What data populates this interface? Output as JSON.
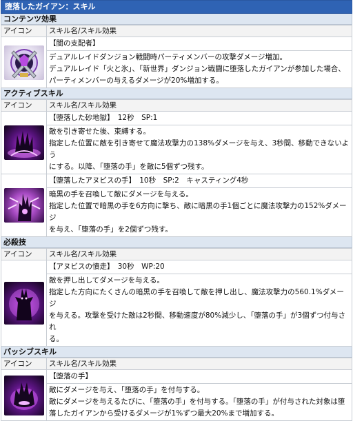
{
  "title": "堕落したガイアン：スキル",
  "header": {
    "icon": "アイコン",
    "name": "スキル名/スキル効果"
  },
  "sections": [
    {
      "label": "コンテンツ効果",
      "skills": [
        {
          "icon": "crossed-swords-crest-icon",
          "name": "【闇の支配者】",
          "lines": [
            "デュアルレイドダンジョン戦闘時パーティメンバーの攻撃ダメージ増加。",
            "デュアルレイド「火と氷」、「新世界」ダンジョン戦闘に堕落したガイアンが参加した場合、",
            "パーティメンバーの与えるダメージが20%増加する。"
          ]
        }
      ]
    },
    {
      "label": "アクティブスキル",
      "skills": [
        {
          "icon": "dark-claw-burst-icon",
          "name": "【堕落した砂地獄】　12秒　SP:1",
          "lines": [
            "敵を引き寄せた後、束縛する。",
            "指定した位置に敵を引き寄せて魔法攻撃力の138%ダメージを与え、3秒間、移動できないよう",
            "にする。以降、「堕落の手」を敵に5個ずつ残す。"
          ]
        },
        {
          "icon": "dark-hand-summon-icon",
          "name": "【堕落したアヌビスの手】　10秒　SP:2　キャスティング4秒",
          "lines": [
            "暗黒の手を召喚して敵にダメージを与える。",
            "指定した位置で暗黒の手を6方向に撃ち、敵に暗黒の手1個ごとに魔法攻撃力の152%ダメージ",
            "を与え、「堕落の手」を2個ずつ残す。"
          ]
        }
      ]
    },
    {
      "label": "必殺技",
      "skills": [
        {
          "icon": "anubis-wrath-icon",
          "name": "【アヌビスの憤走】　30秒　WP:20",
          "lines": [
            "敵を押し出してダメージを与える。",
            "指定した方向にたくさんの暗黒の手を召喚して敵を押し出し、魔法攻撃力の560.1%ダメージ",
            "を与える。攻撃を受けた敵は2秒間、移動速度が80%減少し、「堕落の手」が3個ずつ付与され",
            "る。"
          ]
        }
      ]
    },
    {
      "label": "パッシブスキル",
      "skills": [
        {
          "icon": "fallen-hand-mark-icon",
          "name": "【堕落の手】",
          "lines": [
            "敵にダメージを与え、「堕落の手」を付与する。",
            "敵にダメージを与えるたびに、「堕落の手」を付与する。「堕落の手」が付与された対象は堕",
            "落したガイアンから受けるダメージが1%ずつ最大20%まで増加する。"
          ]
        }
      ]
    }
  ]
}
